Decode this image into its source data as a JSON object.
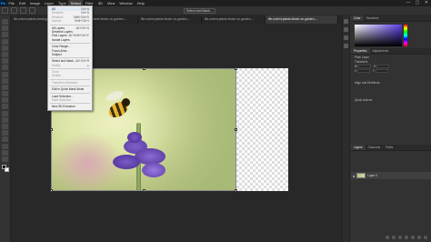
{
  "app": {
    "logo": "Ps"
  },
  "menubar": {
    "items": [
      "File",
      "Edit",
      "Image",
      "Layer",
      "Type",
      "Select",
      "Filter",
      "3D",
      "View",
      "Window",
      "Help"
    ],
    "active_index": 5,
    "window_controls": [
      "—",
      "▢",
      "✕"
    ]
  },
  "options_bar": {
    "buttons": [
      "Select and Mask..."
    ]
  },
  "tabs": [
    {
      "label": "file-rodent-plants-small-grass-...",
      "active": false
    },
    {
      "label": "file-rodent-plants-flower-on-garden-...",
      "active": false
    },
    {
      "label": "file-rodent-plants-flower-on-garden-...",
      "active": false
    },
    {
      "label": "file-rodent-plants-flower-on-garden-...",
      "active": false
    },
    {
      "label": "file-rodent-plants-flower-on-garden-...",
      "active": true
    }
  ],
  "select_menu": {
    "items": [
      {
        "label": "All",
        "key": "Ctrl+A",
        "disabled": false
      },
      {
        "label": "Deselect",
        "key": "Ctrl+D",
        "disabled": true
      },
      {
        "label": "Reselect",
        "key": "Shift+Ctrl+D",
        "disabled": true
      },
      {
        "label": "Inverse",
        "key": "Shift+Ctrl+I",
        "disabled": true
      },
      {
        "sep": true
      },
      {
        "label": "All Layers",
        "key": "Alt+Ctrl+A",
        "disabled": false
      },
      {
        "label": "Deselect Layers",
        "key": "",
        "disabled": false
      },
      {
        "label": "Find Layers",
        "key": "Alt+Shift+Ctrl+F",
        "disabled": false
      },
      {
        "label": "Isolate Layers",
        "key": "",
        "disabled": false
      },
      {
        "sep": true
      },
      {
        "label": "Color Range...",
        "key": "",
        "disabled": false
      },
      {
        "label": "Focus Area...",
        "key": "",
        "disabled": false
      },
      {
        "label": "Subject",
        "key": "",
        "disabled": false
      },
      {
        "sep": true
      },
      {
        "label": "Select and Mask...",
        "key": "Alt+Ctrl+R",
        "disabled": false
      },
      {
        "label": "Modify",
        "key": "▸",
        "disabled": true
      },
      {
        "sep": true
      },
      {
        "label": "Grow",
        "key": "",
        "disabled": true
      },
      {
        "label": "Similar",
        "key": "",
        "disabled": true
      },
      {
        "sep": true
      },
      {
        "label": "Transform Selection",
        "key": "",
        "disabled": true
      },
      {
        "sep": true
      },
      {
        "label": "Edit in Quick Mask Mode",
        "key": "",
        "disabled": false
      },
      {
        "sep": true
      },
      {
        "label": "Load Selection...",
        "key": "",
        "disabled": false
      },
      {
        "label": "Save Selection...",
        "key": "",
        "disabled": true
      },
      {
        "sep": true
      },
      {
        "label": "New 3D Extrusion",
        "key": "",
        "disabled": false
      }
    ]
  },
  "right_panel": {
    "top_tabs": [
      "Color",
      "Swatches"
    ],
    "properties_tabs": [
      "Properties",
      "Adjustments"
    ],
    "properties_lines": [
      "Pixel Layer",
      "Transform",
      "W",
      "H",
      "X",
      "Y",
      "Align and Distribute",
      "Quick Actions"
    ],
    "layers_tabs": [
      "Layers",
      "Channels",
      "Paths"
    ],
    "layer_name": "Layer 0"
  }
}
